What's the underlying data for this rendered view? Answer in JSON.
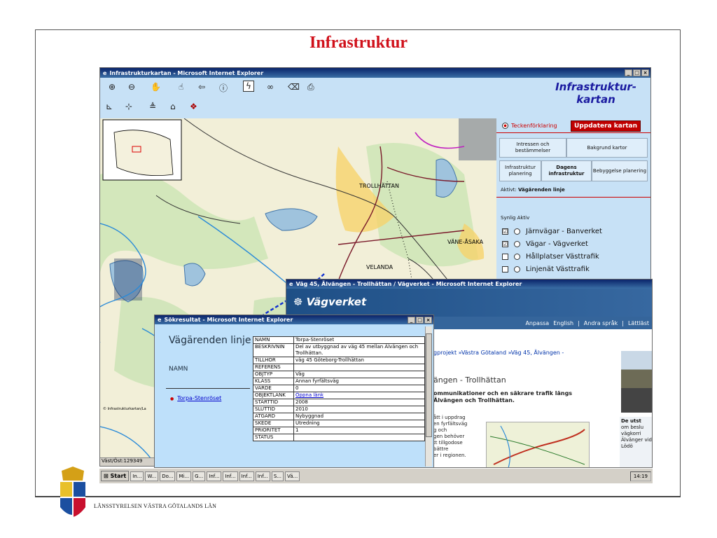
{
  "slide": {
    "title": "Infrastruktur",
    "footer": "LÄNSSTYRELSEN VÄSTRA GÖTALANDS LÄN"
  },
  "ie_window": {
    "title": "Infrastrukturkartan - Microsoft Internet Explorer",
    "brand_line1": "Infrastruktur-",
    "brand_line2": "kartan",
    "status": "Väst/Öst:129349",
    "map_labels": [
      "TROLLHÄTTAN",
      "VÄNE-ÅSAKA",
      "VELANDA"
    ],
    "map_credit": "© Infrastrukturkartan/La"
  },
  "sidebar": {
    "legend_label": "Teckenförklaring",
    "update_button": "Uppdatera kartan",
    "tabs": [
      {
        "label": "Intressen och bestämmelser"
      },
      {
        "label": "Bakgrund kartor"
      },
      {
        "label": "Infrastruktur planering"
      },
      {
        "label": "Dagens infrastruktur"
      },
      {
        "label": "Bebyggelse planering"
      }
    ],
    "active_prefix": "Aktivt:",
    "active_value": "Vägärenden linje",
    "col_synlig": "Synlig",
    "col_aktiv": "Aktiv",
    "layers": [
      {
        "label": "Järnvägar - Banverket",
        "checked": "☑"
      },
      {
        "label": "Vägar - Vägverket",
        "checked": "☑"
      },
      {
        "label": "Hållplatser Västtrafik",
        "checked": ""
      },
      {
        "label": "Linjenät Västtrafik",
        "checked": ""
      }
    ]
  },
  "vagverket_window": {
    "title": "Väg 45, Älvängen - Trollhättan / Vägverket - Microsoft Internet Explorer",
    "logo": "Vägverket",
    "nav": [
      "Anpassa",
      "English",
      "Andra språk",
      "Lättläst"
    ],
    "breadcrumb_link": "gprojekt",
    "breadcrumb_rest": " »Västra Götaland »Väg 45, Älvängen -",
    "heading": "ängen - Trollhättan",
    "lead": "ommunikationer och en säkrare trafik längs Älvängen och Trollhättan.",
    "body": [
      "ått i uppdrag",
      "en fyrfältsväg",
      "g och",
      "gen behöver",
      "tt tillgodose",
      "bättre",
      "er i regionen."
    ],
    "aside_title": "De utst",
    "aside_text": "om beslu vägkorri Älvänger vid Lödö"
  },
  "search_window": {
    "title": "Sökresultat - Microsoft Internet Explorer",
    "heading": "Vägärenden linje",
    "namn_label": "NAMN",
    "result_link": "Torpa-Stenröset",
    "attributes": [
      {
        "k": "NAMN",
        "v": "Torpa-Stenröset"
      },
      {
        "k": "BESKRIVNIN",
        "v": "Del av utbyggnad av väg 45 mellan Älvängen och Trollhättan."
      },
      {
        "k": "TILLHOR",
        "v": "väg 45 Göteborg-Trollhättan"
      },
      {
        "k": "REFERENS",
        "v": ""
      },
      {
        "k": "OBJTYP",
        "v": "Väg"
      },
      {
        "k": "KLASS",
        "v": "Annan fyrfältsväg"
      },
      {
        "k": "VARDE",
        "v": "0"
      },
      {
        "k": "OBJEKTLANK",
        "v": "Öppna länk"
      },
      {
        "k": "STARTTID",
        "v": "2008"
      },
      {
        "k": "SLUTTID",
        "v": "2010"
      },
      {
        "k": "ATGARD",
        "v": "Nybyggnad"
      },
      {
        "k": "SKEDE",
        "v": "Utredning"
      },
      {
        "k": "PRIORITET",
        "v": "1"
      },
      {
        "k": "STATUS",
        "v": ""
      }
    ]
  },
  "taskbar": {
    "start": "Start",
    "buttons": [
      "In...",
      "W...",
      "Do...",
      "Mi...",
      "G...",
      "Inf...",
      "Inf...",
      "Inf...",
      "Inf...",
      "S...",
      "Vä..."
    ],
    "clock": "14:19"
  }
}
